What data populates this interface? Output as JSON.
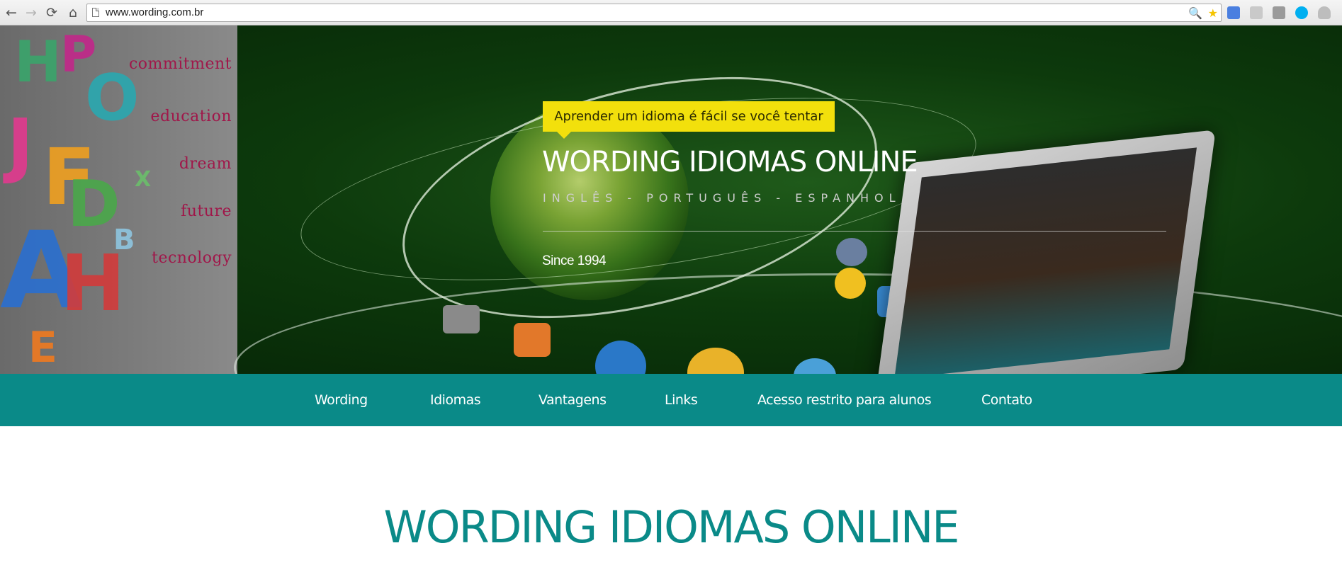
{
  "browser": {
    "url": "www.wording.com.br",
    "nav": {
      "back": "←",
      "forward": "→",
      "reload": "⟳",
      "home": "⌂"
    },
    "omnibox_icons": {
      "zoom": "zoom-icon",
      "bookmark": "bookmark-star-icon"
    },
    "extensions": [
      "google-translate-icon",
      "extension-icon",
      "extension-icon",
      "skype-icon",
      "cloud-icon"
    ],
    "colors": {
      "star": "#f5c400",
      "translate": "#4a7fe0",
      "skype": "#00aff0"
    }
  },
  "hero": {
    "collage_words": [
      "commitment",
      "education",
      "dream",
      "future",
      "tecnology"
    ],
    "tagline": "Aprender um idioma é fácil se você tentar",
    "title": "WORDING IDIOMAS ONLINE",
    "subtitle": "INGLÊS - PORTUGUÊS - ESPANHOL",
    "since": "Since 1994",
    "colors": {
      "tag_background": "#f2e00c",
      "collage_word": "#a0174a"
    }
  },
  "nav": {
    "items": [
      "Wording",
      "Idiomas",
      "Vantagens",
      "Links",
      "Acesso restrito para alunos",
      "Contato"
    ],
    "background": "#0a8a88"
  },
  "content": {
    "title": "WORDING IDIOMAS ONLINE",
    "color": "#0a8a88"
  }
}
